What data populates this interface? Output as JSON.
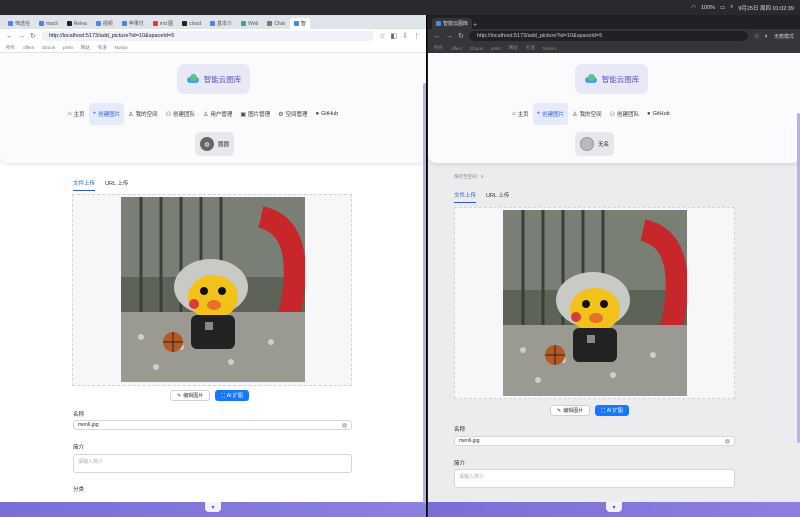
{
  "mac_bar": {
    "battery": "100%",
    "datetime": "9月25日 周四 01:02:39"
  },
  "left_window": {
    "tabs": [
      "筛选任",
      "macli",
      "Relea",
      "视频",
      "苹果付",
      "md 图",
      "cloud",
      "基本介",
      "Web",
      "Chat",
      "智"
    ],
    "url": "http://localhost:5173/add_picture?id=10&spaceId=5",
    "bookmarks": [
      "所有",
      "offers",
      "Ebook",
      "pmkt",
      "网站",
      "有道",
      "Notion"
    ]
  },
  "right_window": {
    "tab_title": "智能云图库",
    "url": "http://localhost:5173/add_picture?id=10&spaceId=5",
    "incognito": "无痕模式",
    "bookmarks": [
      "所有",
      "offers",
      "Ebook",
      "pmkt",
      "网站",
      "有道",
      "Notion"
    ]
  },
  "site": {
    "logo_text": "智能云图库",
    "menu": [
      "主页",
      "创建图片",
      "我的空间",
      "创建团队",
      "用户管理",
      "图片管理",
      "空间管理",
      "GitHub"
    ],
    "menu_right": [
      "主页",
      "创建图片",
      "我的空间",
      "创建团队",
      "GitHub"
    ],
    "user_left": "圆圆",
    "user_right": "无名",
    "space_caption": "保存至空间：5"
  },
  "upload": {
    "tabs": [
      "文件上传",
      "URL 上传"
    ],
    "edit_button": "编辑图片",
    "ai_button": "AI 扩图",
    "name_label": "名称",
    "name_value": "men6.jpg",
    "desc_label": "简介",
    "desc_placeholder": "请输入简介",
    "category_label": "分类"
  },
  "colors": {
    "accent": "#1677ff",
    "brand": "#5b4fd0"
  }
}
